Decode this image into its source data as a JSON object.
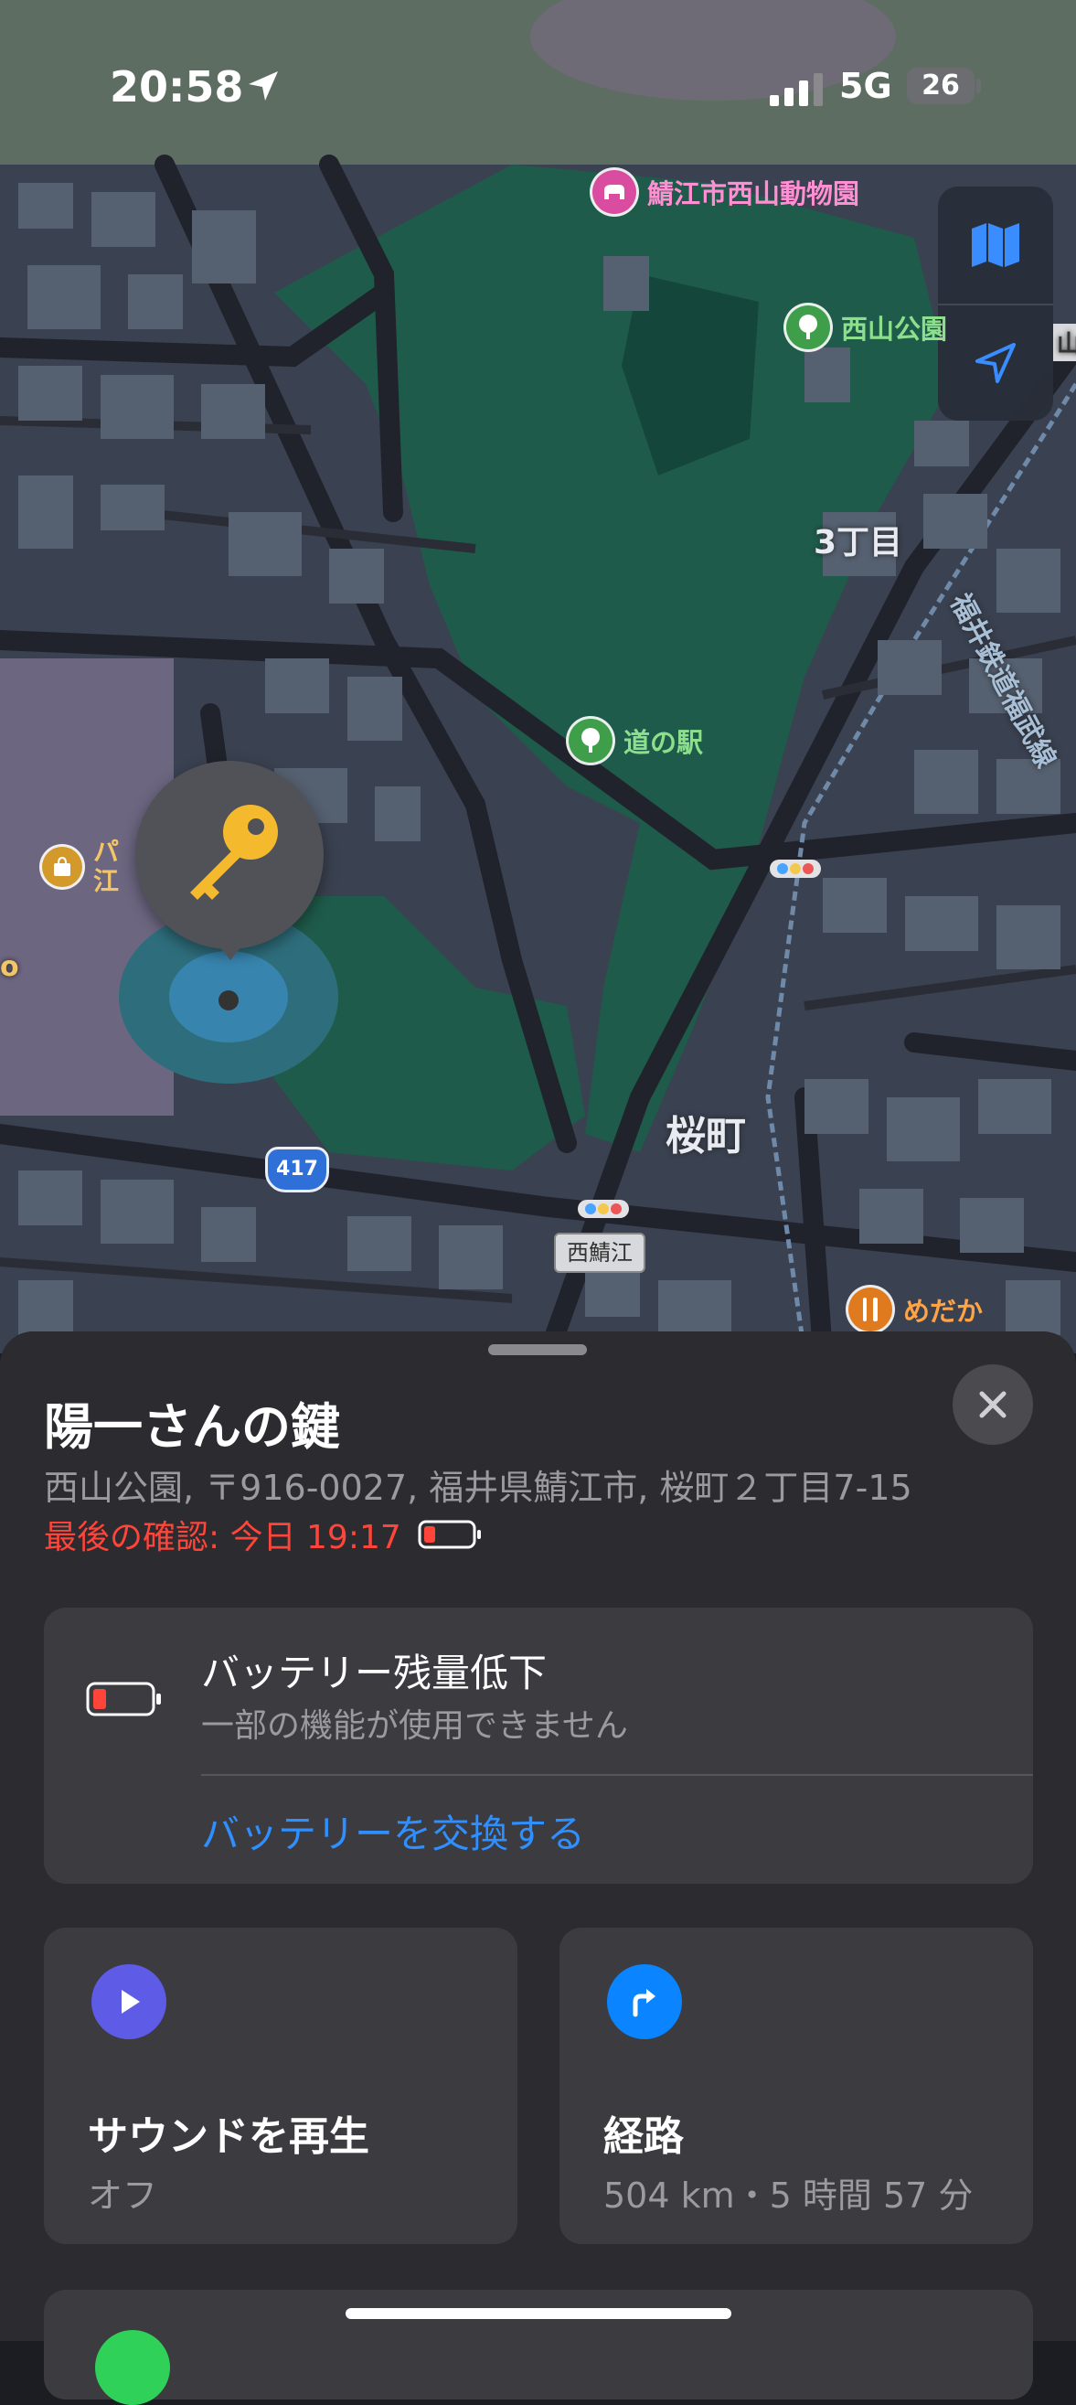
{
  "status_bar": {
    "time": "20:58",
    "network": "5G",
    "battery": "26"
  },
  "map": {
    "pois": {
      "zoo": "鯖江市西山動物園",
      "park": "西山公園",
      "station": "道の駅",
      "shop": "パ\n江",
      "restaurant": "めだか"
    },
    "labels": {
      "district1": "3丁目",
      "district2": "桜町",
      "railway": "福井鉄道福武線",
      "edge_left": "o",
      "edge_right": "山"
    },
    "route_number": "417",
    "station_tag": "西鯖江"
  },
  "sheet": {
    "title": "陽一さんの鍵",
    "address": "西山公園, 〒916-0027, 福井県鯖江市, 桜町２丁目7-15",
    "last_seen": "最後の確認: 今日 19:17",
    "battery_card": {
      "title": "バッテリー残量低下",
      "subtitle": "一部の機能が使用できません",
      "link": "バッテリーを交換する"
    },
    "actions": {
      "sound": {
        "label": "サウンドを再生",
        "sub": "オフ"
      },
      "route": {
        "label": "経路",
        "sub": "504 km・5 時間 57 分"
      }
    }
  },
  "colors": {
    "accent_blue": "#2f8fff",
    "warning_red": "#ff453a",
    "sound_purple": "#5e5ce6",
    "route_blue": "#0a84ff",
    "park_green": "#1f5b4a"
  },
  "icons": {
    "location": "location-arrow-icon",
    "map_mode": "map-icon",
    "tracking": "navigation-arrow-icon",
    "key": "key-icon",
    "close": "close-icon",
    "battery_low": "battery-low-icon",
    "play": "play-icon",
    "route": "turn-right-arrow-icon"
  }
}
